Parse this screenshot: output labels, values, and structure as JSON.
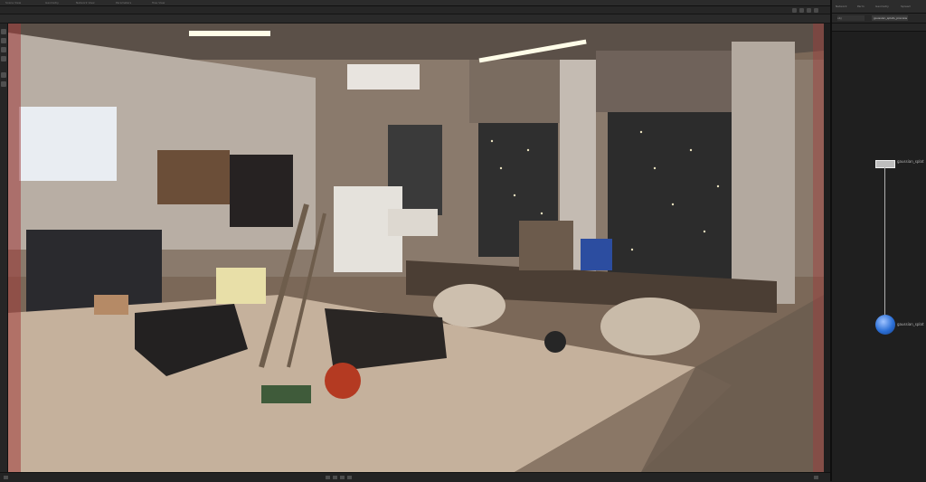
{
  "menubar": {
    "tabs": [
      "Scene View",
      "Geometry",
      "Network View",
      "Parameters",
      "Tree View"
    ]
  },
  "viewport": {
    "camera_label": "persp_view",
    "image_alt": "Reconstructed 3D gaussian splat of a cluttered workshop/maker-space with a long wooden table, chairs, shelves and windows with string lights"
  },
  "node_panel": {
    "tabs": [
      "Network",
      "Parm",
      "Geometry",
      "Spread"
    ],
    "path_label": "obj",
    "path_value": "gaussian_splats_preview",
    "nodes": [
      {
        "label": "gaussian_splat"
      },
      {
        "label": "gaussian_splat"
      }
    ]
  },
  "colors": {
    "accent_node": "#3b82f6",
    "frame_border": "#a03c3c"
  }
}
